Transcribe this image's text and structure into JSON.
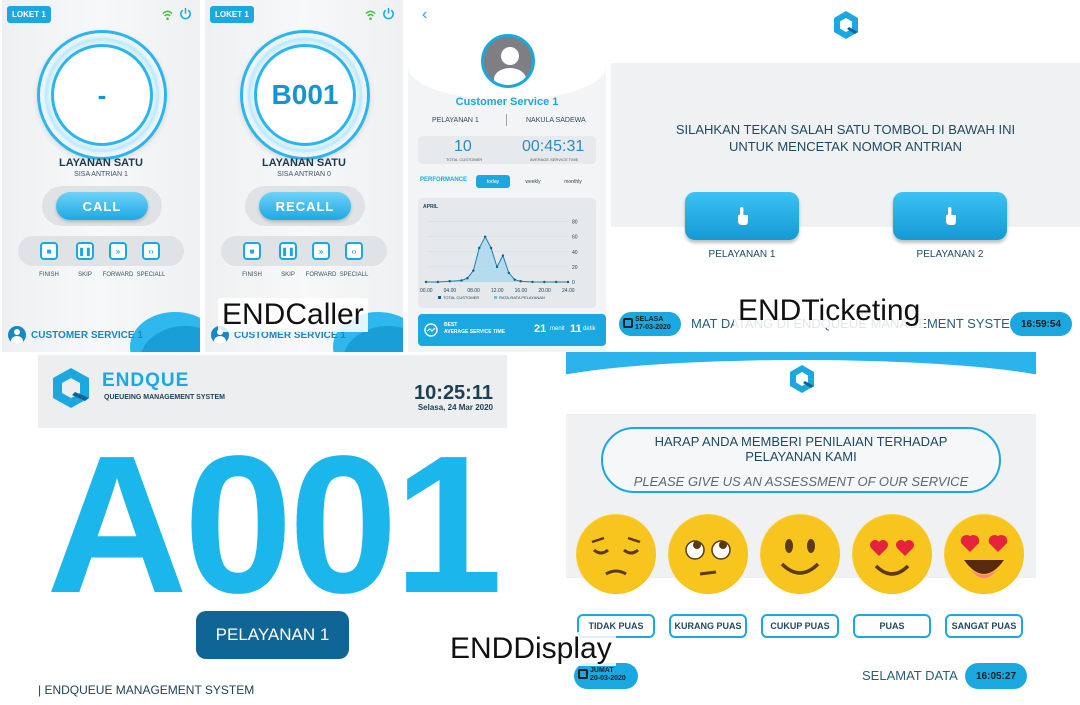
{
  "caller1": {
    "loket": "LOKET 1",
    "number": "-",
    "service": "LAYANAN SATU",
    "remaining": "SISA ANTRIAN 1",
    "action": "CALL",
    "controls": [
      "FINISH",
      "SKIP",
      "FORWARD",
      "SPECIALL"
    ],
    "footer": "CUSTOMER SERVICE 1"
  },
  "caller2": {
    "loket": "LOKET 1",
    "number": "B001",
    "service": "LAYANAN SATU",
    "remaining": "SISA ANTRIAN 0",
    "action": "RECALL",
    "controls": [
      "FINISH",
      "SKIP",
      "FORWARD",
      "SPECIALL"
    ],
    "footer": "CUSTOMER SERVICE 1"
  },
  "performance": {
    "title": "Customer Service 1",
    "service": "PELAYANAN 1",
    "officer": "NAKULA SADEWA",
    "total_customer": "10",
    "total_customer_label": "TOTAL CUSTOMER",
    "avg_time": "00:45:31",
    "avg_time_label": "AVERAGE SERVICE TIME",
    "section_label": "PERFORMANCE",
    "tabs": [
      "today",
      "weekly",
      "monthly"
    ],
    "chart_title": "APRIL",
    "legend": [
      "TOTAL CUSTOMER",
      "RATA-RATA PELAYANAN"
    ],
    "best_label_1": "BEST",
    "best_label_2": "AVERAGE SERVICE TIME",
    "best_min": "21",
    "best_min_unit": "menit",
    "best_sec": "11",
    "best_sec_unit": "detik"
  },
  "chart_data": {
    "type": "line",
    "title": "APRIL",
    "x_ticks": [
      "00.00",
      "04.00",
      "08.00",
      "12.00",
      "16.00",
      "20.00",
      "24.00"
    ],
    "y_ticks": [
      "0",
      "20",
      "40",
      "60",
      "80"
    ],
    "ylim": [
      0,
      90
    ],
    "series": [
      {
        "name": "TOTAL CUSTOMER",
        "x": [
          0,
          2,
          4,
          6,
          7,
          8,
          9,
          10,
          11,
          12,
          13,
          14,
          15,
          16,
          18,
          20,
          22,
          24
        ],
        "values": [
          0,
          0,
          1,
          2,
          5,
          15,
          45,
          60,
          45,
          20,
          35,
          12,
          3,
          1,
          0,
          0,
          0,
          0
        ]
      }
    ]
  },
  "ticketing": {
    "instruction_1": "SILAHKAN TEKAN SALAH SATU TOMBOL DI BAWAH INI",
    "instruction_2": "UNTUK MENCETAK NOMOR ANTRIAN",
    "buttons": [
      "PELAYANAN 1",
      "PELAYANAN 2"
    ],
    "marquee": "MAT DATANG DI ENDQUEUE MANAGEMENT SYSTEM",
    "day": "SELASA",
    "date": "17-03-2020",
    "time": "16:59:54"
  },
  "display": {
    "brand": "ENDQUE",
    "brand_sub": "QUEUEING MANAGEMENT SYSTEM",
    "clock": "10:25:11",
    "date": "Selasa, 24 Mar 2020",
    "number": "A001",
    "service": "PELAYANAN 1",
    "footer": "| ENDQUEUE MANAGEMENT SYSTEM"
  },
  "survey": {
    "question_1": "HARAP ANDA MEMBERI PENILAIAN TERHADAP",
    "question_2": "PELAYANAN KAMI",
    "question_en": "PLEASE GIVE US AN ASSESSMENT OF OUR SERVICE",
    "ratings": [
      "TIDAK PUAS",
      "KURANG PUAS",
      "CUKUP PUAS",
      "PUAS",
      "SANGAT PUAS"
    ],
    "marquee": "SELAMAT DATA",
    "day": "JUMAT",
    "date": "20-03-2020",
    "time": "16:05:27"
  },
  "captions": {
    "caller": "ENDCaller",
    "ticketing": "ENDTicketing",
    "display": "ENDDisplay"
  },
  "colors": {
    "accent": "#1ba8e0",
    "dark": "#0f6595",
    "text": "#1d3f55"
  }
}
